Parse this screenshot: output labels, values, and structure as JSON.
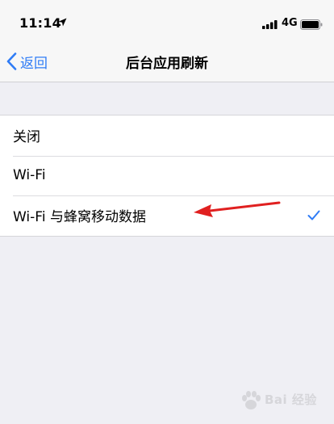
{
  "status_bar": {
    "time": "11:14",
    "network": "4G",
    "icons": [
      "location-arrow-icon",
      "signal-bars-icon",
      "battery-icon"
    ]
  },
  "nav": {
    "back_label": "返回",
    "title": "后台应用刷新"
  },
  "options": [
    {
      "label": "关闭",
      "selected": false
    },
    {
      "label": "Wi-Fi",
      "selected": false
    },
    {
      "label": "Wi-Fi 与蜂窝移动数据",
      "selected": true
    }
  ],
  "colors": {
    "accent": "#2f7cf6",
    "background": "#efeff4",
    "annotation": "#e02020"
  },
  "watermark": {
    "text": "Bai  经验"
  }
}
